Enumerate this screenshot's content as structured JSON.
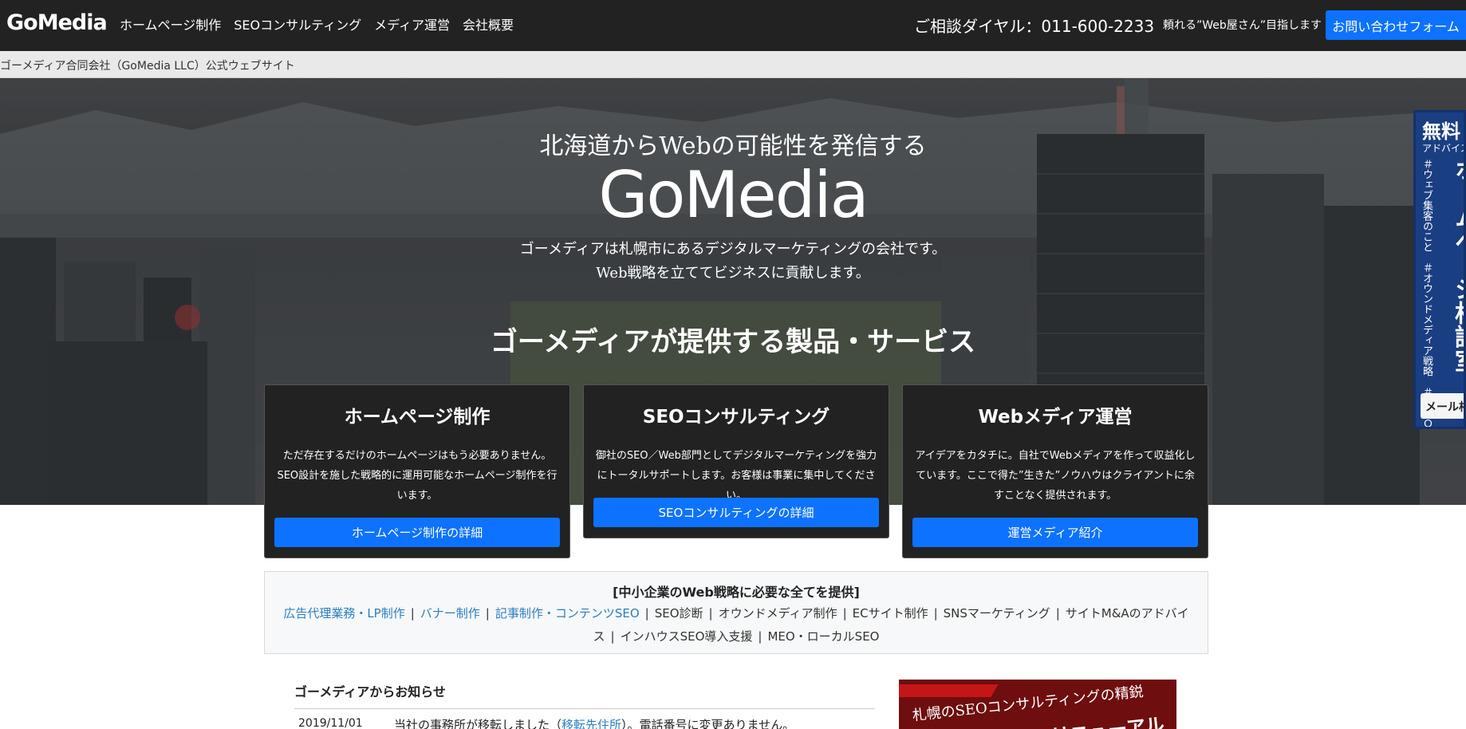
{
  "header": {
    "logo": "GoMedia",
    "nav": [
      "ホームページ制作",
      "SEOコンサルティング",
      "メディア運営",
      "会社概要"
    ],
    "dial": "ご相談ダイヤル：011-600-2233",
    "tagline": "頼れる”Web屋さん”目指します",
    "contact_button": "お問い合わせフォーム"
  },
  "subbar": {
    "text": "ゴーメディア合同会社（GoMedia LLC）公式ウェブサイト"
  },
  "hero": {
    "kicker": "北海道からWebの可能性を発信する",
    "logo": "GoMedia",
    "desc_line1": "ゴーメディアは札幌市にあるデジタルマーケティングの会社です。",
    "desc_line2": "Web戦略を立ててビジネスに貢献します。",
    "services_title": "ゴーメディアが提供する製品・サービス"
  },
  "side_banner": {
    "free": "無料",
    "advice": "アドバイス",
    "title": "ホームページ相談室",
    "tags": "＃ウェブ集客のこと　＃オウンドメディア戦略　＃ＳＥＯのこと　＃迷っていること　＃その他相談",
    "mail_button": "メール相談"
  },
  "cards": [
    {
      "title": "ホームページ制作",
      "text": "ただ存在するだけのホームページはもう必要ありません。SEO設計を施した戦略的に運用可能なホームページ制作を行います。",
      "button": "ホームページ制作の詳細"
    },
    {
      "title": "SEOコンサルティング",
      "text": "御社のSEO／Web部門としてデジタルマーケティングを強力にトータルサポートします。お客様は事業に集中してください。",
      "button": "SEOコンサルティングの詳細"
    },
    {
      "title": "Webメディア運営",
      "text": "アイデアをカタチに。自社でWebメディアを作って収益化しています。ここで得た”生きた”ノウハウはクライアントに余すことなく提供されます。",
      "button": "運営メディア紹介"
    }
  ],
  "services_box": {
    "title": "[中小企業のWeb戦略に必要な全てを提供]",
    "items": [
      {
        "label": "広告代理業務・LP制作",
        "link": true
      },
      {
        "label": "バナー制作",
        "link": true
      },
      {
        "label": "記事制作・コンテンツSEO",
        "link": true
      },
      {
        "label": "SEO診断",
        "link": false
      },
      {
        "label": "オウンドメディア制作",
        "link": false
      },
      {
        "label": "ECサイト制作",
        "link": false
      },
      {
        "label": "SNSマーケティング",
        "link": false
      },
      {
        "label": "サイトM&Aのアドバイス",
        "link": false
      },
      {
        "label": "インハウスSEO導入支援",
        "link": false
      },
      {
        "label": "MEO・ローカルSEO",
        "link": false
      }
    ]
  },
  "news": {
    "title": "ゴーメディアからお知らせ",
    "items": [
      {
        "date": "2019/11/01",
        "text_before": "当社の事務所が移転しました（",
        "link": "移転先住所",
        "text_after": "）。電話番号に変更ありません。"
      }
    ]
  },
  "promo_banner": {
    "line1": "札幌のSEOコンサルティングの精鋭",
    "line2": "リニューアル"
  },
  "colors": {
    "accent": "#0d72ff",
    "dark": "#222222",
    "link": "#2a7fc1"
  }
}
